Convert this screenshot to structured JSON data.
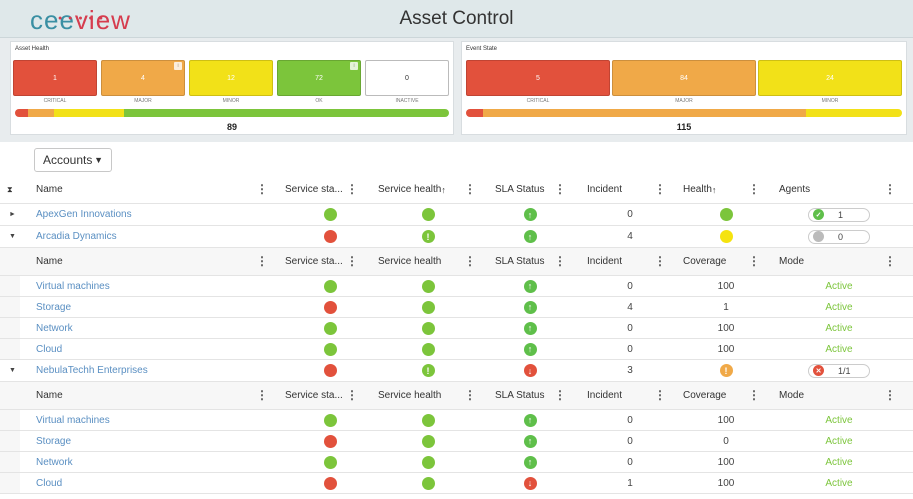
{
  "header": {
    "logo": "ceeview",
    "title": "Asset Control"
  },
  "asset_health": {
    "title": "Asset Health",
    "tiles": [
      {
        "value": "1",
        "label": "CRITICAL",
        "color": "#e2513c"
      },
      {
        "value": "4",
        "label": "MAJOR",
        "color": "#f0a948"
      },
      {
        "value": "12",
        "label": "MINOR",
        "color": "#f2e118"
      },
      {
        "value": "72",
        "label": "OK",
        "color": "#7cc53b"
      },
      {
        "value": "0",
        "label": "INACTIVE",
        "color": "#ffffff"
      }
    ],
    "total": "89"
  },
  "event_state": {
    "title": "Event State",
    "tiles": [
      {
        "value": "5",
        "label": "CRITICAL",
        "color": "#e2513c"
      },
      {
        "value": "84",
        "label": "MAJOR",
        "color": "#f0a948"
      },
      {
        "value": "24",
        "label": "MINOR",
        "color": "#f2e118"
      }
    ],
    "total": "115"
  },
  "accounts_dropdown": {
    "label": "Accounts"
  },
  "main_columns": {
    "name": "Name",
    "service_status": "Service sta...",
    "service_health": "Service health",
    "sla": "SLA Status",
    "incident": "Incident",
    "health": "Health",
    "agents": "Agents"
  },
  "sub_columns": {
    "name": "Name",
    "service_status": "Service sta...",
    "service_health": "Service health",
    "sla": "SLA Status",
    "incident": "Incident",
    "coverage": "Coverage",
    "mode": "Mode"
  },
  "accounts": [
    {
      "name": "ApexGen Innovations",
      "status": "green",
      "health": "green",
      "sla": "up",
      "incident": "0",
      "agg_health": "green",
      "agents": "1",
      "agent_state": "ok"
    },
    {
      "name": "Arcadia Dynamics",
      "status": "red",
      "health": "warn",
      "sla": "up",
      "incident": "4",
      "agg_health": "yellow",
      "agents": "0",
      "agent_state": "none",
      "children": [
        {
          "name": "Virtual machines",
          "status": "green",
          "health": "green",
          "sla": "up",
          "incident": "0",
          "coverage": "100",
          "mode": "Active"
        },
        {
          "name": "Storage",
          "status": "red",
          "health": "green",
          "sla": "up",
          "incident": "4",
          "coverage": "1",
          "mode": "Active"
        },
        {
          "name": "Network",
          "status": "green",
          "health": "green",
          "sla": "up",
          "incident": "0",
          "coverage": "100",
          "mode": "Active"
        },
        {
          "name": "Cloud",
          "status": "green",
          "health": "green",
          "sla": "up",
          "incident": "0",
          "coverage": "100",
          "mode": "Active"
        }
      ]
    },
    {
      "name": "NebulaTechh Enterprises",
      "status": "red",
      "health": "warn",
      "sla": "down",
      "incident": "3",
      "agg_health": "warn-orange",
      "agents": "1/1",
      "agent_state": "error",
      "children": [
        {
          "name": "Virtual machines",
          "status": "green",
          "health": "green",
          "sla": "up",
          "incident": "0",
          "coverage": "100",
          "mode": "Active"
        },
        {
          "name": "Storage",
          "status": "red",
          "health": "green",
          "sla": "up",
          "incident": "0",
          "coverage": "0",
          "mode": "Active"
        },
        {
          "name": "Network",
          "status": "green",
          "health": "green",
          "sla": "up",
          "incident": "0",
          "coverage": "100",
          "mode": "Active"
        },
        {
          "name": "Cloud",
          "status": "red",
          "health": "green",
          "sla": "down",
          "incident": "1",
          "coverage": "100",
          "mode": "Active"
        }
      ]
    }
  ]
}
